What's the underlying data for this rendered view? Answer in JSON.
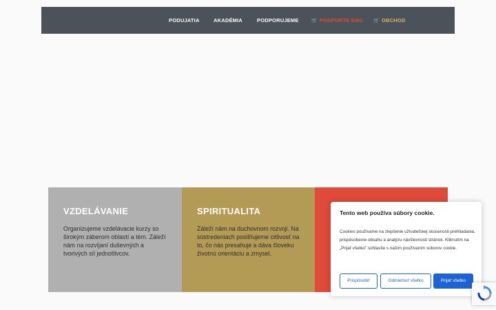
{
  "nav": {
    "items": [
      {
        "label": "PODUJATIA"
      },
      {
        "label": "AKADÉMIA"
      },
      {
        "label": "PODPORUJEME"
      },
      {
        "label": "PODPORTE EMC",
        "icon": "cart-icon"
      },
      {
        "label": "OBCHOD",
        "icon": "cart-icon"
      }
    ]
  },
  "cards": [
    {
      "title": "VZDELÁVANIE",
      "text": "Organizujeme vzdelávacie kurzy so širokým záberom oblastí a tém. Záleží nám na rozvíjaní duševných a tvorivých síl jednotlivcov.",
      "color": "#b0b0b0"
    },
    {
      "title": "SPIRITUALITA",
      "text": "Záleží nám na duchovnom rozvoji. Na sústredeniach posilňujeme citlivosť na to, čo nás presahuje a dáva človeku životnú orientáciu a zmysel.",
      "color": "#b39a55"
    },
    {
      "color": "#e04a3a"
    }
  ],
  "cookie": {
    "title": "Tento web používa súbory cookie.",
    "text": "Cookies používame na zlepšenie užívateľskej skúsenosti prehliadania, prispôsobenie obsahu a analýzu návštevnosti stránok. Kliknutím na „Prijať všetko\" súhlasíte s naším používaním súborov cookie.",
    "customize": "Prispôsobiť",
    "reject": "Odmietnuť všetko",
    "accept": "Prijať všetko"
  },
  "colors": {
    "navbar": "#4b525a",
    "accent_red": "#e04a34",
    "accent_gold": "#d7b46d",
    "button_blue": "#1e63d6"
  }
}
